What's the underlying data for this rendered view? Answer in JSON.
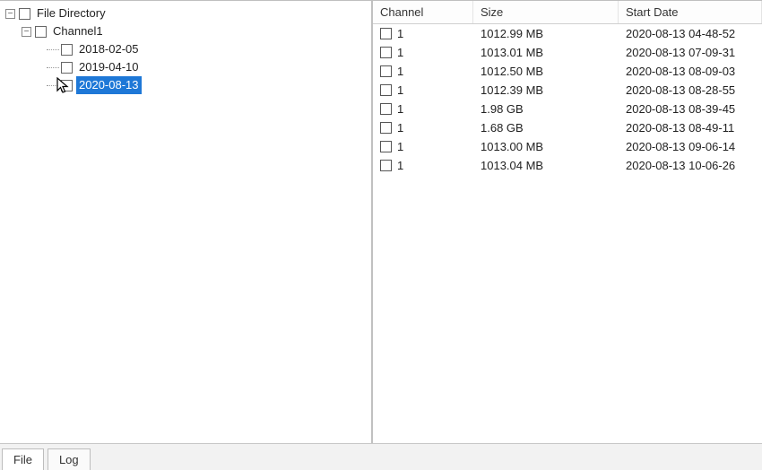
{
  "tree": {
    "root_label": "File Directory",
    "channel_label": "Channel1",
    "dates": [
      "2018-02-05",
      "2019-04-10",
      "2020-08-13"
    ],
    "selected_index": 2
  },
  "columns": {
    "channel": "Channel",
    "size": "Size",
    "date": "Start Date"
  },
  "files": [
    {
      "channel": "1",
      "size": "1012.99 MB",
      "date": "2020-08-13 04-48-52"
    },
    {
      "channel": "1",
      "size": "1013.01 MB",
      "date": "2020-08-13 07-09-31"
    },
    {
      "channel": "1",
      "size": "1012.50 MB",
      "date": "2020-08-13 08-09-03"
    },
    {
      "channel": "1",
      "size": "1012.39 MB",
      "date": "2020-08-13 08-28-55"
    },
    {
      "channel": "1",
      "size": "1.98 GB",
      "date": "2020-08-13 08-39-45"
    },
    {
      "channel": "1",
      "size": "1.68 GB",
      "date": "2020-08-13 08-49-11"
    },
    {
      "channel": "1",
      "size": "1013.00 MB",
      "date": "2020-08-13 09-06-14"
    },
    {
      "channel": "1",
      "size": "1013.04 MB",
      "date": "2020-08-13 10-06-26"
    }
  ],
  "tabs": {
    "file": "File",
    "log": "Log",
    "active": "file"
  }
}
